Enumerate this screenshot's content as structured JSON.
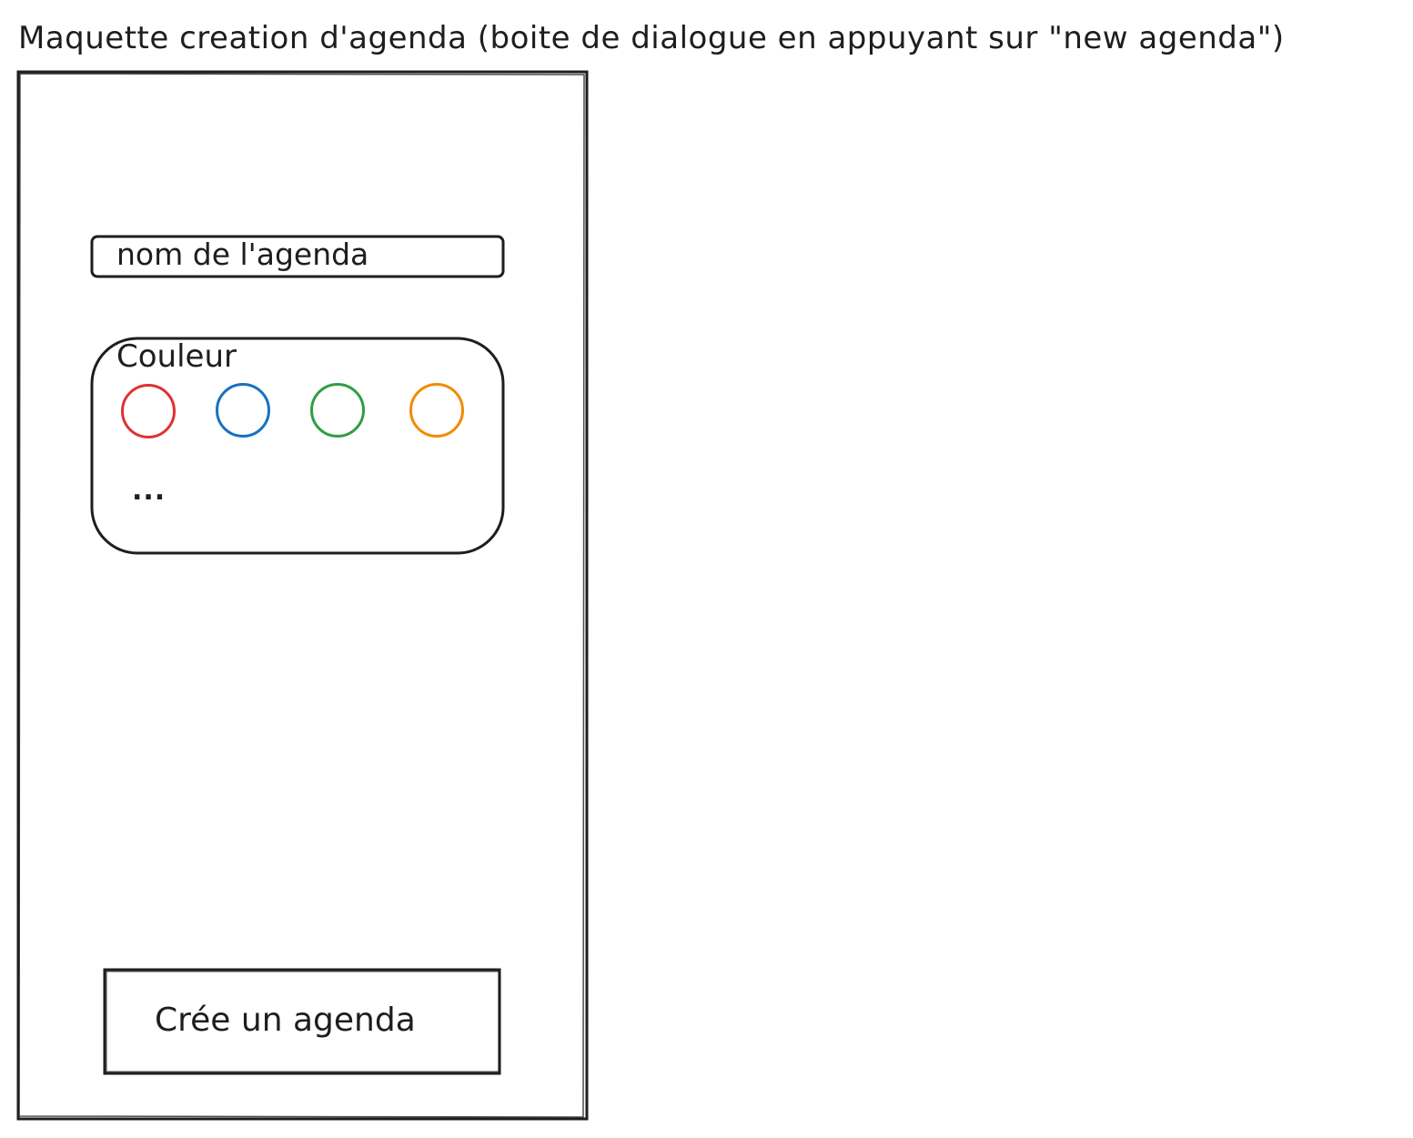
{
  "title": "Maquette creation d'agenda (boite de dialogue en appuyant sur \"new agenda\")",
  "dialog": {
    "name_field": {
      "placeholder": "nom de l'agenda"
    },
    "color_section": {
      "label": "Couleur",
      "swatches": [
        {
          "name": "red",
          "color": "#e03131"
        },
        {
          "name": "blue",
          "color": "#1971c2"
        },
        {
          "name": "green",
          "color": "#2f9e44"
        },
        {
          "name": "orange",
          "color": "#f08c00"
        }
      ],
      "more_label": "..."
    },
    "create_button_label": "Crée un agenda"
  }
}
